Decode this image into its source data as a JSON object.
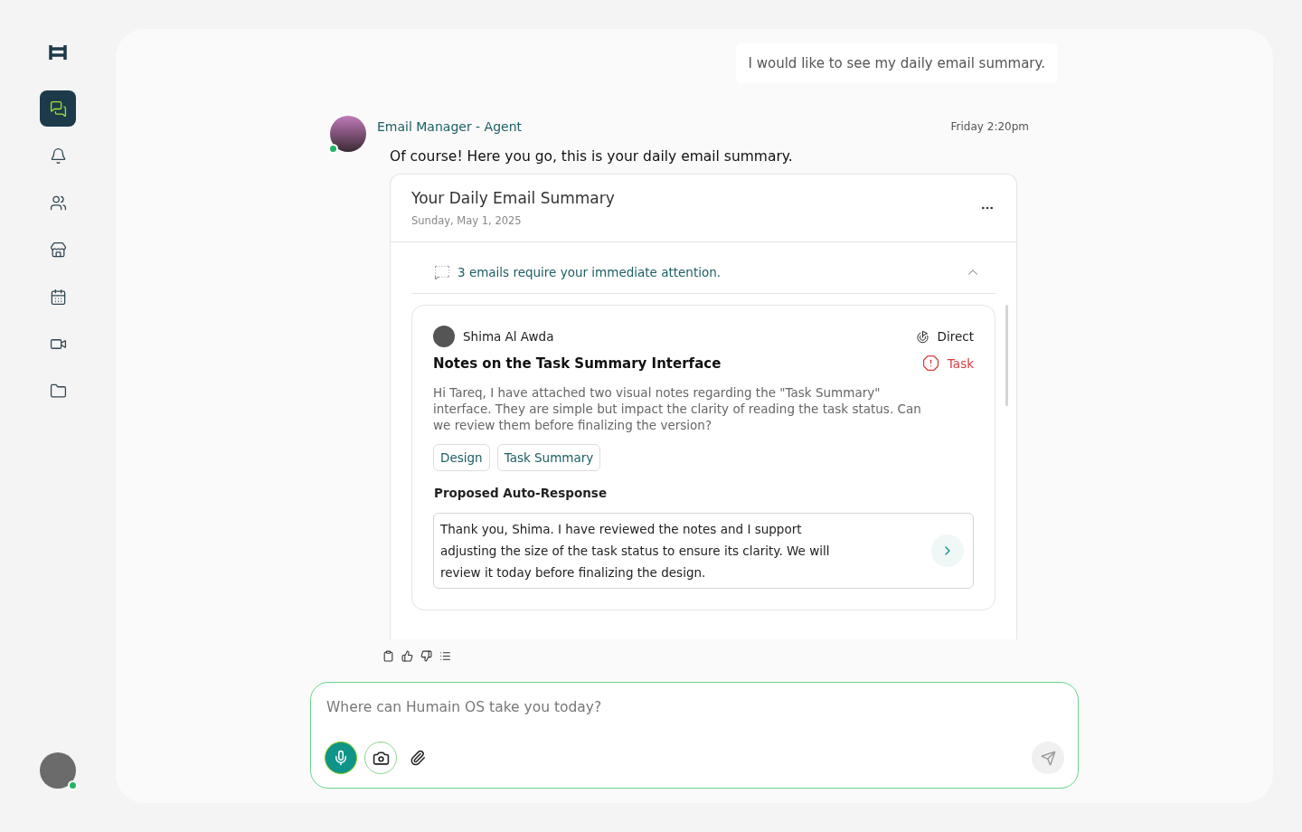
{
  "sidebar": {
    "items": [
      {
        "kind": "chat",
        "selected": true
      },
      {
        "kind": "bell",
        "selected": false
      },
      {
        "kind": "users",
        "selected": false
      },
      {
        "kind": "store",
        "selected": false
      },
      {
        "kind": "calendar",
        "selected": false
      },
      {
        "kind": "video",
        "selected": false
      },
      {
        "kind": "folder",
        "selected": false
      }
    ],
    "user": {
      "online": true
    }
  },
  "user_message": "I would like to see my daily email summary.",
  "agent": {
    "name": "Email Manager - Agent",
    "online": true,
    "time": "Friday 2:20pm",
    "text": "Of course! Here you go, this is your daily email summary."
  },
  "summary": {
    "title": "Your Daily Email Summary",
    "date": "Sunday, May 1, 2025",
    "attention": "3 emails require your immediate attention.",
    "expanded": true,
    "emails": [
      {
        "sender": "Shima Al Awda",
        "subject": "Notes on the Task Summary Interface",
        "channel": "Direct",
        "type": "Task",
        "body": "Hi Tareq, I have attached two visual notes regarding the \"Task Summary\" interface. They are simple but impact the clarity of reading the task status. Can we review them before finalizing the version?",
        "tags": [
          "Design",
          "Task Summary"
        ],
        "response_label": "Proposed Auto-Response",
        "response": "Thank you, Shima. I have reviewed the notes and I support adjusting the size of the task status to ensure its clarity. We will review it today before finalizing the design."
      }
    ]
  },
  "composer": {
    "placeholder": "Where can Humain OS take you today?"
  }
}
